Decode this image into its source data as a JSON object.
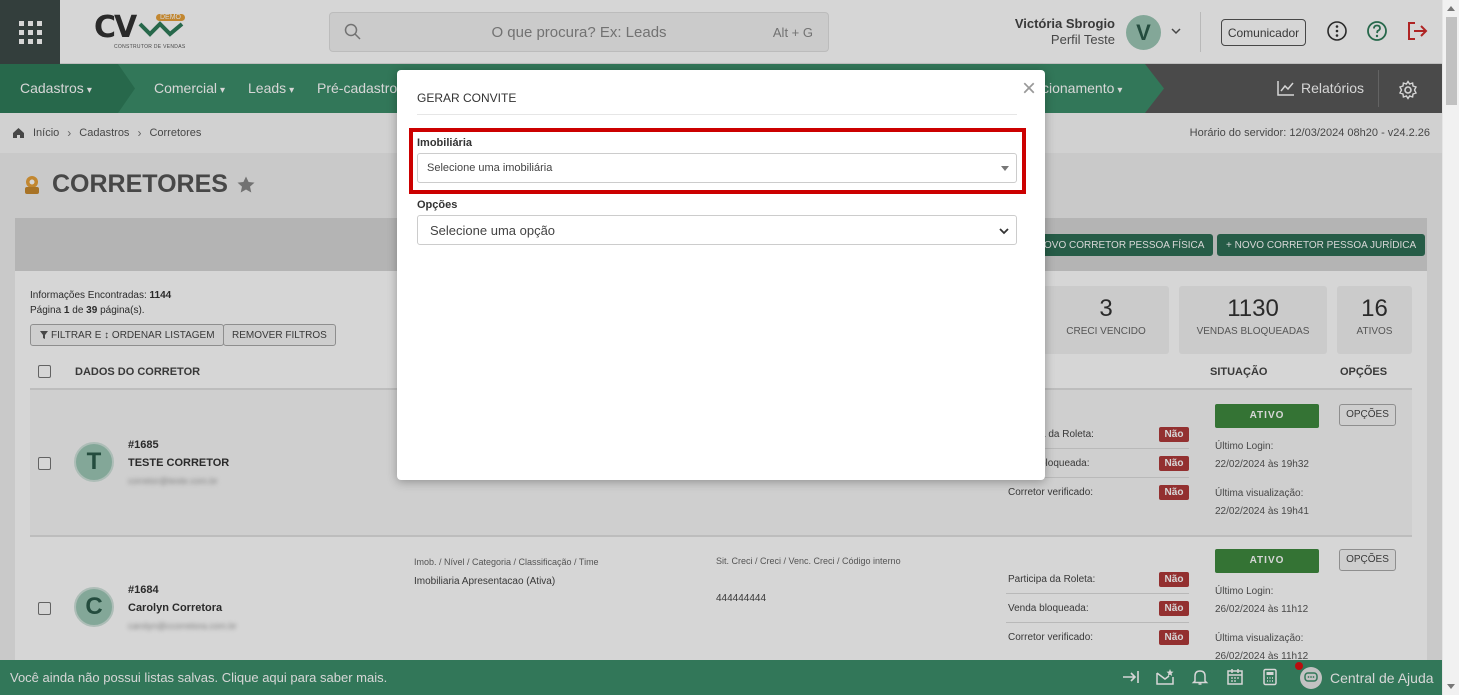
{
  "header": {
    "logo_text": "CV",
    "logo_badge": "DEMO",
    "logo_subtitle": "CONSTRUTOR DE VENDAS",
    "search_placeholder": "O que procura? Ex: Leads",
    "search_shortcut": "Alt + G",
    "user_name": "Victória Sbrogio",
    "user_role": "Perfil Teste",
    "avatar_letter": "V",
    "communicator_label": "Comunicador"
  },
  "nav": {
    "items": [
      "Cadastros",
      "Comercial",
      "Leads",
      "Pré-cadastros",
      "cionamento"
    ],
    "reports_label": "Relatórios"
  },
  "breadcrumb": {
    "items": [
      "Início",
      "Cadastros",
      "Corretores"
    ],
    "server_time": "Horário do servidor: 12/03/2024 08h20 - v24.2.26"
  },
  "page": {
    "title": "CORRETORES",
    "btn_pf": "OVO CORRETOR PESSOA FÍSICA",
    "btn_pj": "+ NOVO CORRETOR PESSOA JURÍDICA",
    "info_found_label": "Informações Encontradas:",
    "info_found_value": "1144",
    "page_prefix": "Página",
    "page_current": "1",
    "page_of": "de",
    "page_total": "39",
    "page_suffix": "página(s).",
    "filter_btn": "FILTRAR E ↕ ORDENAR LISTAGEM",
    "remove_filters_btn": "REMOVER FILTROS",
    "stats": [
      {
        "value": "3",
        "label": "CRECI VENCIDO"
      },
      {
        "value": "1130",
        "label": "VENDAS BLOQUEADAS"
      },
      {
        "value": "16",
        "label": "ATIVOS"
      }
    ],
    "col_dados": "DADOS DO CORRETOR",
    "col_situacao": "SITUAÇÃO",
    "col_opcoes": "OPÇÕES"
  },
  "rows": [
    {
      "letter": "T",
      "id": "#1685",
      "name": "TESTE CORRETOR",
      "email": "corretor@teste.com.br",
      "imob_header": "",
      "imob_value": "",
      "creci_header": "",
      "creci_value": "",
      "flags": [
        {
          "label": "a da Roleta:",
          "value": "Não"
        },
        {
          "label": "bloqueada:",
          "value": "Não"
        },
        {
          "label": "Corretor verificado:",
          "value": "Não"
        }
      ],
      "status": "ATIVO",
      "options": "OPÇÕES",
      "last_login_label": "Último Login:",
      "last_login": "22/02/2024 às 19h32",
      "last_view_label": "Última visualização:",
      "last_view": "22/02/2024 às 19h41"
    },
    {
      "letter": "C",
      "id": "#1684",
      "name": "Carolyn Corretora",
      "email": "carolyn@ccorretora.com.br",
      "imob_header": "Imob. / Nível / Categoria / Classificação / Time",
      "imob_value": "Imobiliaria Apresentacao (Ativa)",
      "creci_header": "Sit. Creci / Creci / Venc. Creci / Código interno",
      "creci_value": "444444444",
      "flags": [
        {
          "label": "Participa da Roleta:",
          "value": "Não"
        },
        {
          "label": "Venda bloqueada:",
          "value": "Não"
        },
        {
          "label": "Corretor verificado:",
          "value": "Não"
        }
      ],
      "status": "ATIVO",
      "options": "OPÇÕES",
      "last_login_label": "Último Login:",
      "last_login": "26/02/2024 às 11h12",
      "last_view_label": "Última visualização:",
      "last_view": "26/02/2024 às 11h12"
    }
  ],
  "footer": {
    "message": "Você ainda não possui listas salvas. Clique aqui para saber mais.",
    "help_label": "Central de Ajuda"
  },
  "modal": {
    "title": "GERAR CONVITE",
    "close": "×",
    "imobiliaria_label": "Imobiliária",
    "imobiliaria_placeholder": "Selecione uma imobiliária",
    "opcoes_label": "Opções",
    "opcoes_placeholder": "Selecione uma opção"
  },
  "colors": {
    "nav_green": "#3c8e6a",
    "dark_green": "#2e6e55",
    "highlight_red": "#cc0000",
    "status_red": "#b03a3a",
    "ativo_green": "#3e8a3e"
  }
}
